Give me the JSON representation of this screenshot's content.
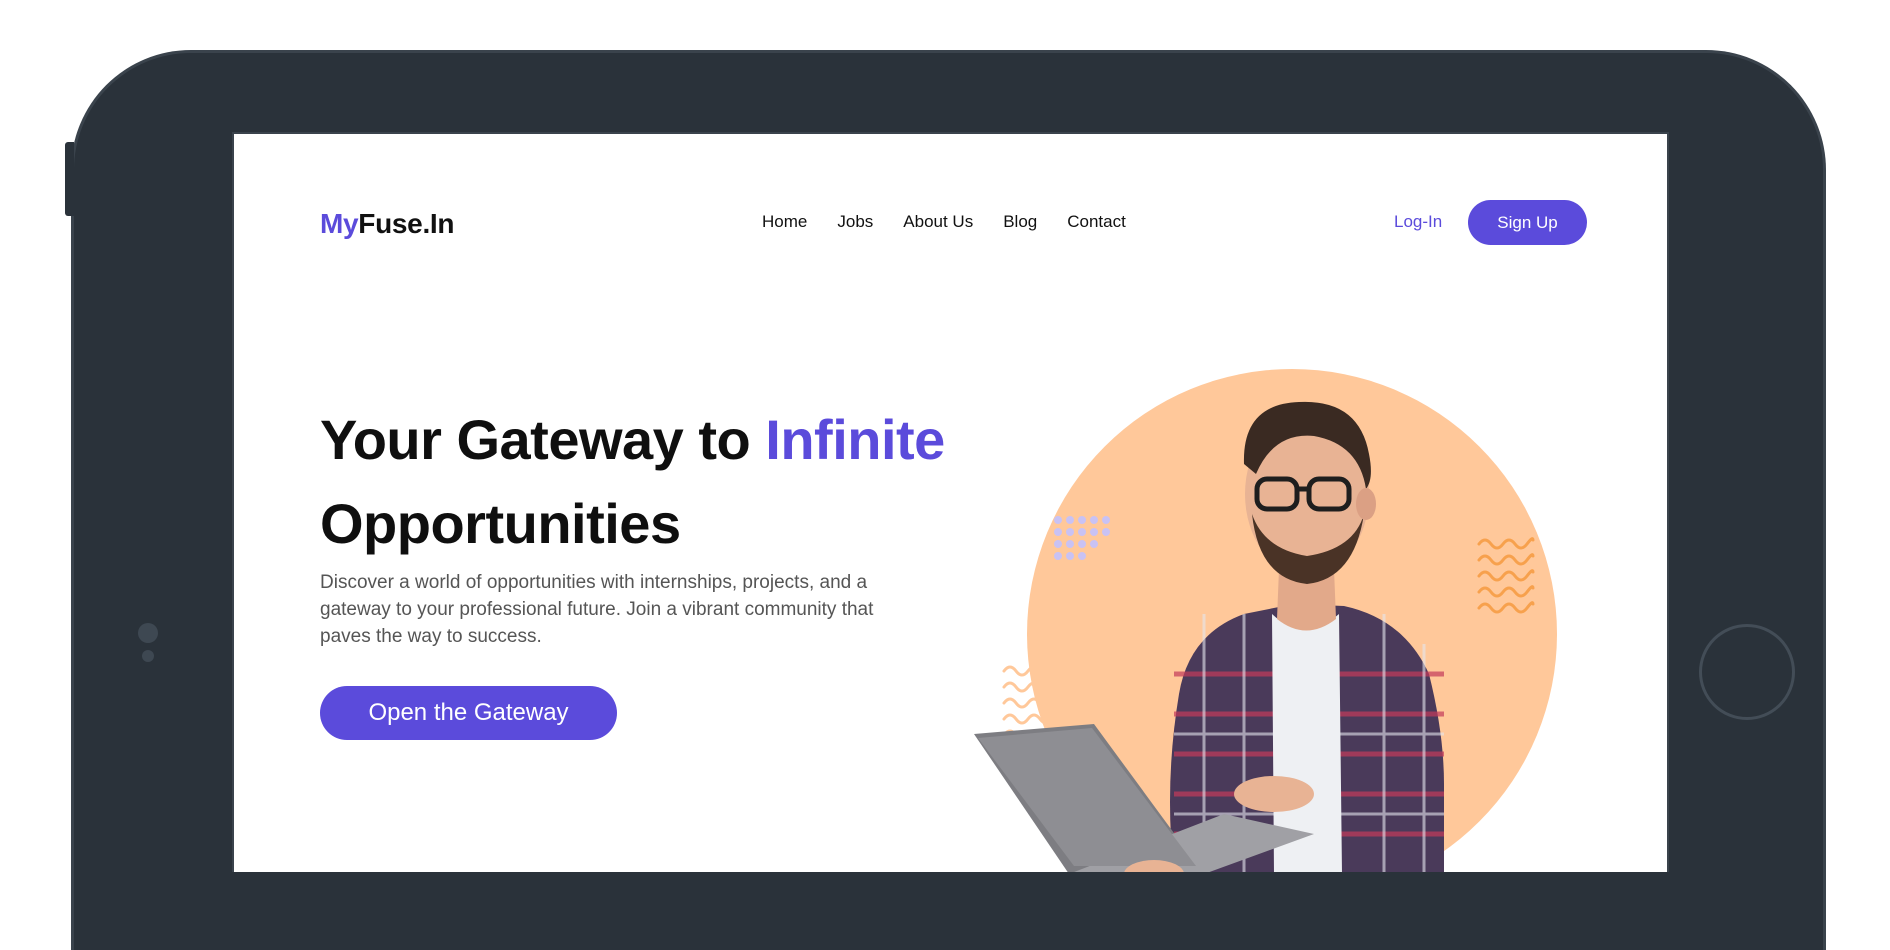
{
  "brand": {
    "logo_prefix": "My",
    "logo_suffix": "Fuse.In"
  },
  "nav": {
    "items": [
      "Home",
      "Jobs",
      "About Us",
      "Blog",
      "Contact"
    ]
  },
  "auth": {
    "login_label": "Log-In",
    "signup_label": "Sign Up"
  },
  "hero": {
    "title_part1": "Your Gateway to ",
    "title_accent": "Infinite",
    "title_part2": "Opportunities",
    "description": "Discover a world of opportunities with internships, projects, and a gateway to your professional future. Join a vibrant community that paves the way to success.",
    "cta_label": "Open the Gateway"
  },
  "colors": {
    "accent": "#5b4bdb",
    "frame": "#2a323a",
    "circle": "#ffc89a",
    "wave": "#f7a14d",
    "dots": "#c9c2f4"
  },
  "icons": {
    "illustration": "man-with-laptop",
    "decor": [
      "dot-grid-icon",
      "wave-pattern-icon"
    ]
  }
}
